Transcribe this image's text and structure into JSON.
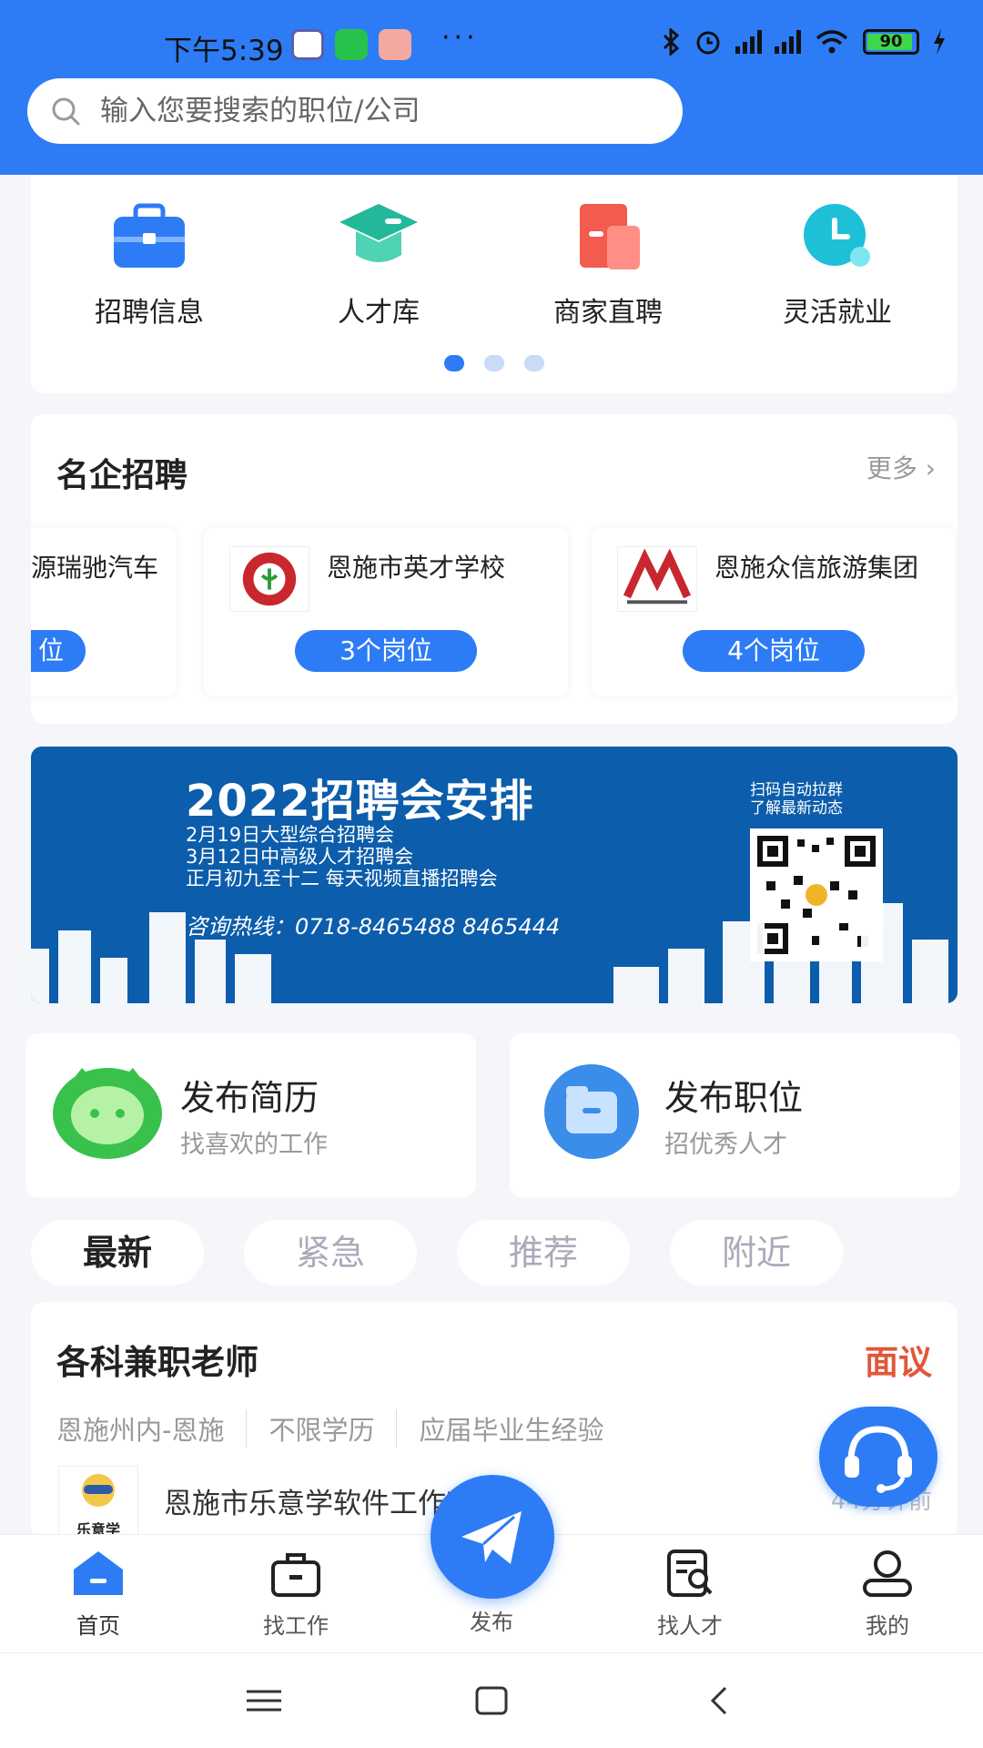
{
  "status_bar": {
    "time": "下午5:39",
    "battery": "90",
    "more": "···"
  },
  "search": {
    "placeholder": "输入您要搜索的职位/公司"
  },
  "categories": [
    {
      "label": "招聘信息",
      "icon": "briefcase-icon",
      "color": "#2d7cf5"
    },
    {
      "label": "人才库",
      "icon": "graduation-cap-icon",
      "color": "#23b89a"
    },
    {
      "label": "商家直聘",
      "icon": "shop-icon",
      "color": "#f25b4e"
    },
    {
      "label": "灵活就业",
      "icon": "clock-icon",
      "color": "#1ec0d8"
    }
  ],
  "famous": {
    "title": "名企招聘",
    "more": "更多",
    "companies": [
      {
        "name": "源瑞驰汽车",
        "button": "位"
      },
      {
        "name": "恩施市英才学校",
        "button": "3个岗位"
      },
      {
        "name": "恩施众信旅游集团",
        "button": "4个岗位"
      }
    ]
  },
  "banner": {
    "title": "2022招聘会安排",
    "line1": "2月19日大型综合招聘会",
    "line2": "3月12日中高级人才招聘会",
    "line3": "正月初九至十二 每天视频直播招聘会",
    "hotline": "咨询热线：0718-8465488  8465444",
    "qr_text1": "扫码自动拉群",
    "qr_text2": "了解最新动态"
  },
  "actions": [
    {
      "title": "发布简历",
      "subtitle": "找喜欢的工作"
    },
    {
      "title": "发布职位",
      "subtitle": "招优秀人才"
    }
  ],
  "tabs": [
    "最新",
    "紧急",
    "推荐",
    "附近"
  ],
  "job": {
    "title": "各科兼职老师",
    "salary": "面议",
    "tags": [
      "恩施州内-恩施",
      "不限学历",
      "应届毕业生经验"
    ],
    "company": "恩施市乐意学软件工作室",
    "time": "44分钟前",
    "logo_text": "乐意学"
  },
  "nav": {
    "home": "首页",
    "find_job": "找工作",
    "post": "发布",
    "find_talent": "找人才",
    "mine": "我的"
  },
  "colors": {
    "primary": "#2d7cf5",
    "salary": "#e2563b"
  }
}
